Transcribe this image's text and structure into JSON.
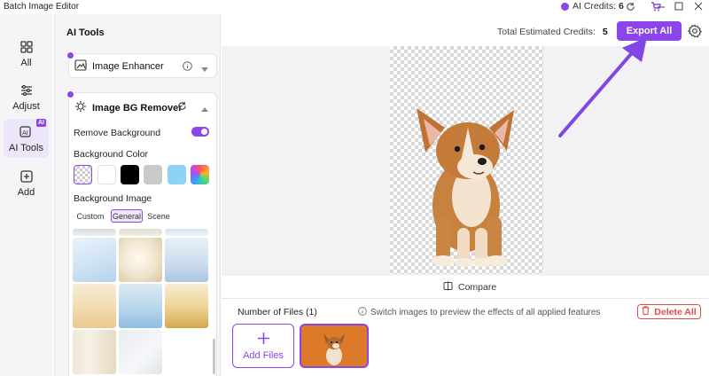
{
  "window": {
    "title": "Batch Image Editor"
  },
  "credits": {
    "label": "AI Credits:",
    "value": "6"
  },
  "nav": {
    "items": [
      {
        "label": "All",
        "icon": "grid-icon"
      },
      {
        "label": "Adjust",
        "icon": "sliders-icon"
      },
      {
        "label": "AI Tools",
        "icon": "ai-icon",
        "badge": "AI"
      },
      {
        "label": "Add",
        "icon": "plus-box-icon"
      }
    ]
  },
  "panel": {
    "title": "AI Tools",
    "enhancer": {
      "label": "Image Enhancer"
    },
    "bg_remover": {
      "label": "Image BG Remover"
    },
    "remove_background": {
      "label": "Remove Background",
      "enabled": true
    },
    "background_color": {
      "label": "Background Color",
      "swatches": [
        "transparent",
        "#ffffff",
        "#000000",
        "#c9c9c9",
        "#8ed3f5",
        "rainbow"
      ]
    },
    "background_image": {
      "label": "Background Image",
      "tabs": [
        "Custom",
        "General",
        "Scene"
      ],
      "selected_tab": "General"
    }
  },
  "main": {
    "estimate_label": "Total Estimated Credits:",
    "estimate_value": "5",
    "export_label": "Export All",
    "compare_label": "Compare",
    "files_label": "Number of Files (1)",
    "hint": "Switch images to preview the effects of all applied features",
    "delete_label": "Delete All",
    "add_files_label": "Add Files"
  },
  "colors": {
    "accent": "#8b45e8",
    "danger": "#e34b4b"
  }
}
